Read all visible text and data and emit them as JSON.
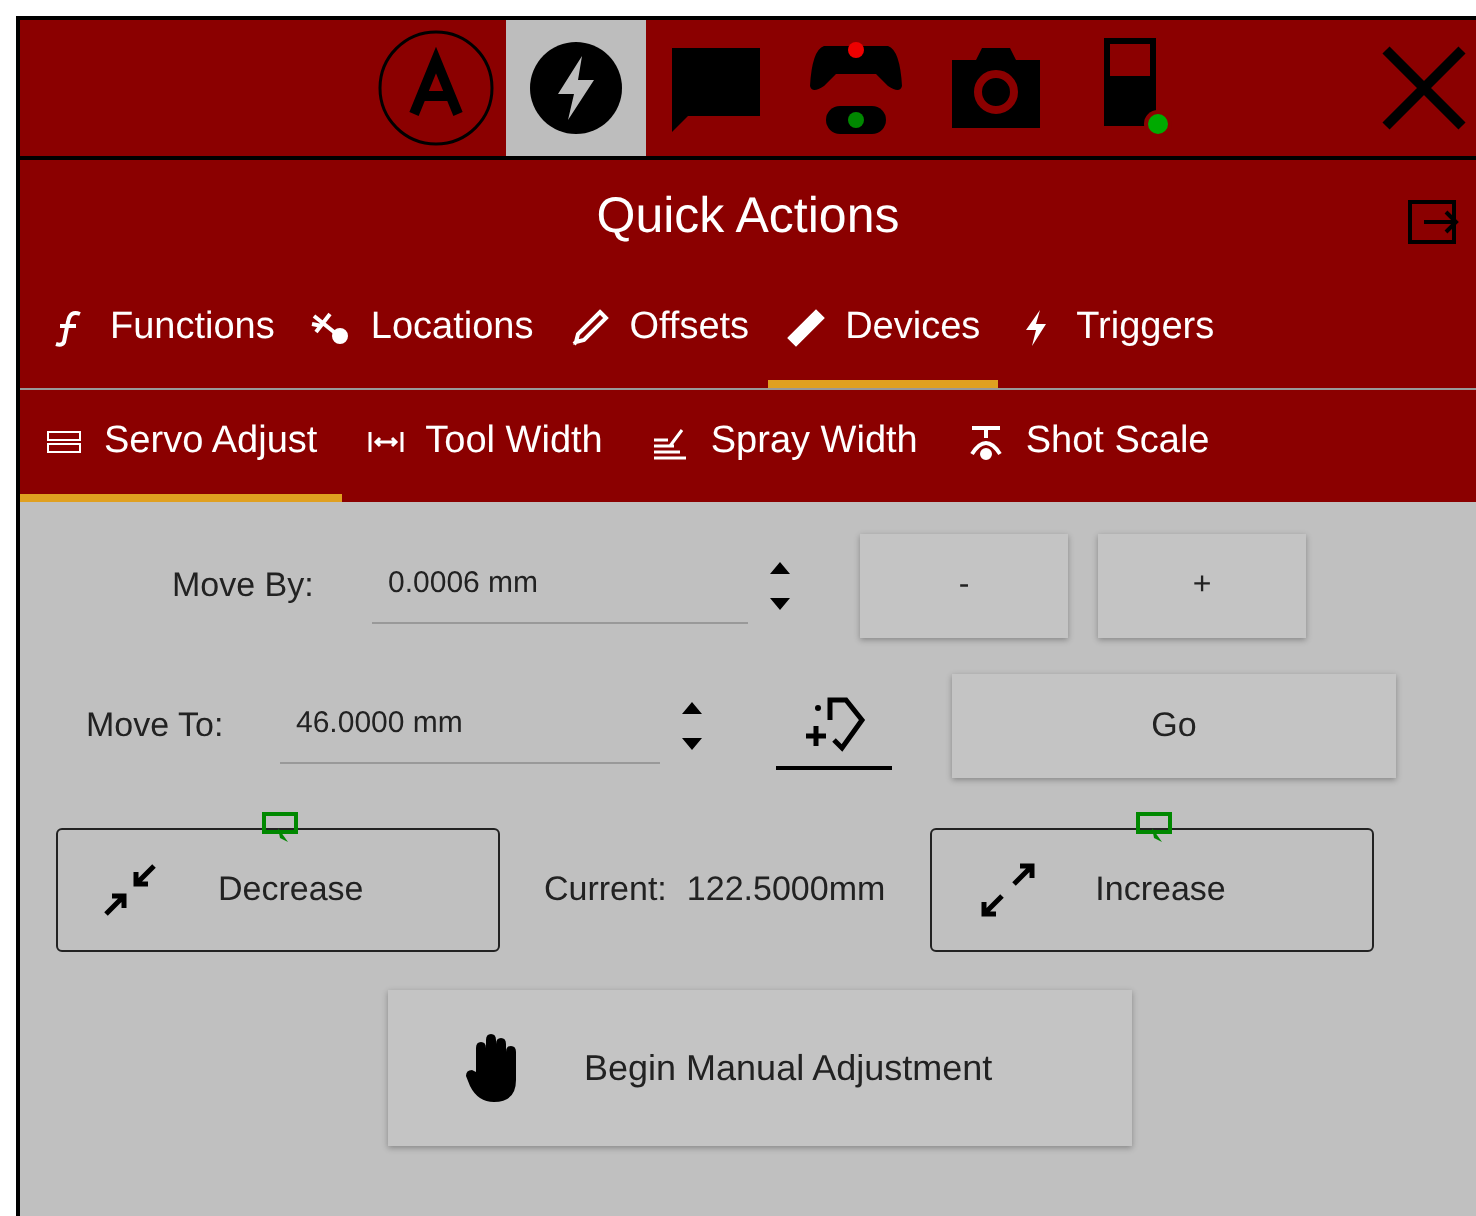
{
  "toolbar": {
    "icons": [
      {
        "kind": "auto",
        "selected": false
      },
      {
        "kind": "bolt",
        "selected": true
      },
      {
        "kind": "chat",
        "selected": false
      },
      {
        "kind": "gamepad",
        "selected": false
      },
      {
        "kind": "camera",
        "selected": false
      },
      {
        "kind": "device",
        "selected": false
      }
    ]
  },
  "panel": {
    "title": "Quick Actions"
  },
  "tabs": [
    {
      "label": "Functions",
      "kind": "f",
      "selected": false
    },
    {
      "label": "Locations",
      "kind": "plane",
      "selected": false
    },
    {
      "label": "Offsets",
      "kind": "pen",
      "selected": false
    },
    {
      "label": "Devices",
      "kind": "ruler",
      "selected": true
    },
    {
      "label": "Triggers",
      "kind": "bolt",
      "selected": false
    }
  ],
  "subtabs": [
    {
      "label": "Servo Adjust",
      "kind": "servo",
      "selected": true
    },
    {
      "label": "Tool Width",
      "kind": "width",
      "selected": false
    },
    {
      "label": "Spray Width",
      "kind": "spray",
      "selected": false
    },
    {
      "label": "Shot Scale",
      "kind": "scale",
      "selected": false
    }
  ],
  "move_by": {
    "label": "Move By:",
    "value": "0.0006 mm",
    "minus": "-",
    "plus": "+"
  },
  "move_to": {
    "label": "Move To:",
    "value": "46.0000 mm",
    "go": "Go"
  },
  "decrease": "Decrease",
  "current_label": "Current:",
  "current_value": "122.5000mm",
  "increase": "Increase",
  "manual": "Begin Manual Adjustment"
}
